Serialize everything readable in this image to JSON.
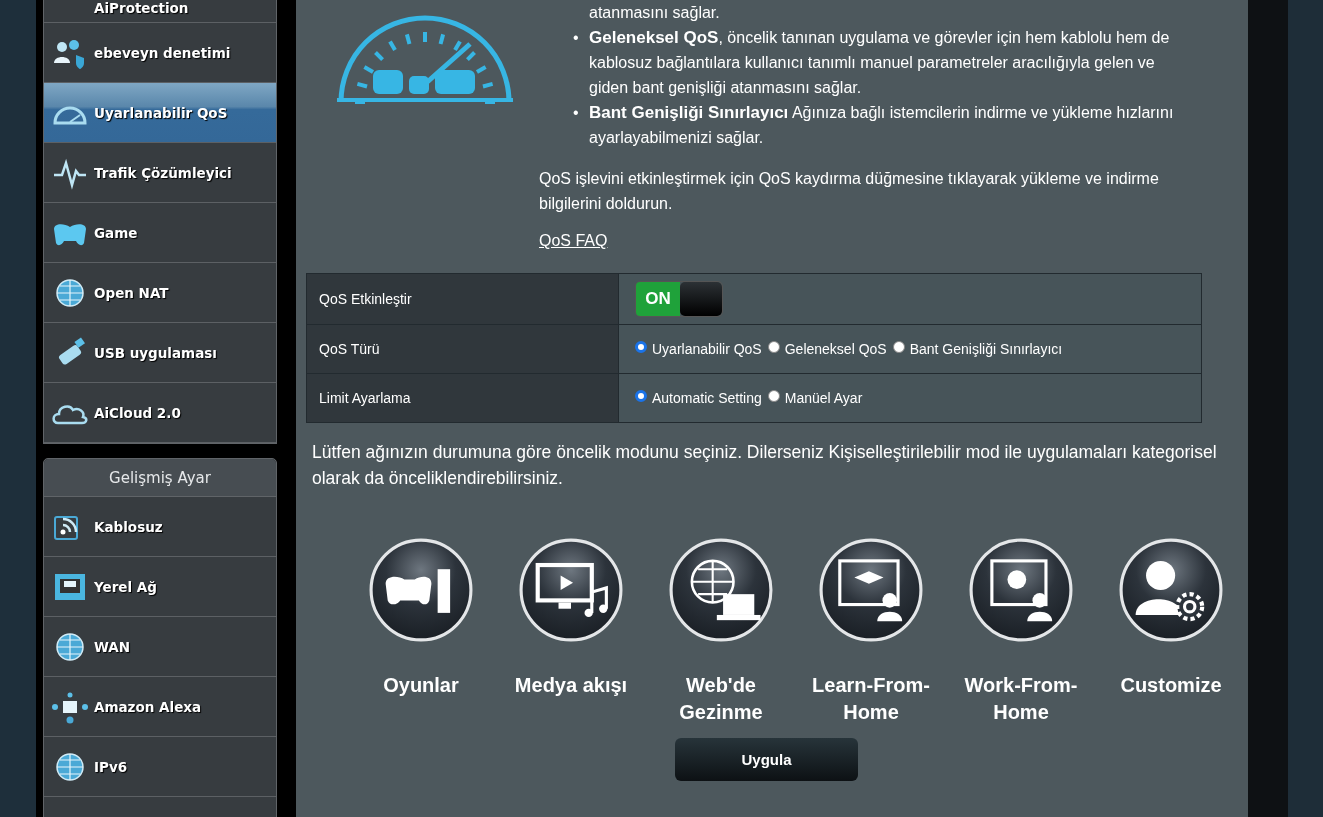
{
  "sidebar": {
    "items": [
      {
        "label": "AiProtection",
        "selected": false
      },
      {
        "label": "ebeveyn denetimi",
        "selected": false
      },
      {
        "label": "Uyarlanabilir QoS",
        "selected": true
      },
      {
        "label": "Trafik Çözümleyici",
        "selected": false
      },
      {
        "label": "Game",
        "selected": false
      },
      {
        "label": "Open NAT",
        "selected": false
      },
      {
        "label": "USB uygulaması",
        "selected": false
      },
      {
        "label": "AiCloud 2.0",
        "selected": false
      }
    ],
    "advanced": {
      "title": "Gelişmiş Ayar",
      "items": [
        {
          "label": "Kablosuz",
          "selected": false
        },
        {
          "label": "Yerel Ağ",
          "selected": false
        },
        {
          "label": "WAN",
          "selected": false
        },
        {
          "label": "Amazon Alexa",
          "selected": false
        },
        {
          "label": "IPv6",
          "selected": false
        }
      ]
    }
  },
  "intro": {
    "continuation": "atanmasını sağlar.",
    "bullets": [
      {
        "marker": "•",
        "text": "**Geleneksel QoS**, öncelik tanınan uygulama ve görevler için hem kablolu hem de kablosuz bağlantılara kullanıcı tanımlı manuel parametreler aracılığıyla gelen ve giden bant genişliği atanmasını sağlar."
      },
      {
        "marker": "•",
        "text": "**Bant Genişliği Sınırlayıcı** Ağınıza bağlı istemcilerin indirme ve yükleme hızlarını ayarlayabilmenizi sağlar."
      }
    ],
    "paragraph": "QoS işlevini etkinleştirmek için QoS kaydırma düğmesine tıklayarak yükleme ve indirme bilgilerini doldurun.",
    "faq_link": "QoS FAQ"
  },
  "settings": [
    {
      "label": "QoS Etkinleştir",
      "kind": "toggle",
      "on": true,
      "on_label": "ON"
    },
    {
      "label": "QoS Türü",
      "kind": "radio",
      "options": [
        {
          "label": "Uyarlanabilir QoS",
          "selected": true
        },
        {
          "label": "Geleneksel QoS",
          "selected": false
        },
        {
          "label": "Bant Genişliği Sınırlayıcı",
          "selected": false
        }
      ]
    },
    {
      "label": "Limit Ayarlama",
      "kind": "radio",
      "options": [
        {
          "label": "Automatic Setting",
          "selected": true
        },
        {
          "label": "Manüel Ayar",
          "selected": false
        }
      ]
    }
  ],
  "mode_hint": "Lütfen ağınızın durumuna göre öncelik modunu seçiniz. Dilerseniz Kişiselleştirilebilir mod ile uygulamaları kategorisel olarak da önceliklendirebilirsiniz.",
  "modes": [
    {
      "label": "Oyunlar"
    },
    {
      "label": "Medya akışı"
    },
    {
      "label": "Web'de Gezinme"
    },
    {
      "label": "Learn-From-Home"
    },
    {
      "label": "Work-From-Home"
    },
    {
      "label": "Customize"
    }
  ],
  "apply_button": "Uygula"
}
